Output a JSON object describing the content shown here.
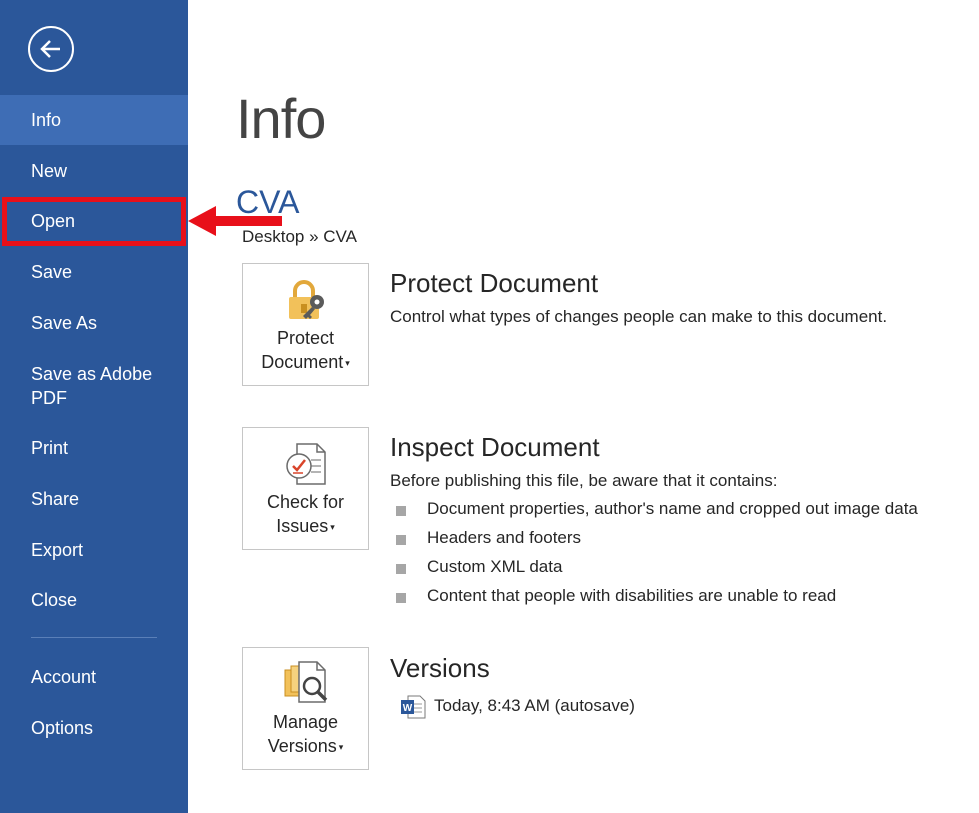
{
  "sidebar": {
    "items": [
      {
        "label": "Info"
      },
      {
        "label": "New"
      },
      {
        "label": "Open"
      },
      {
        "label": "Save"
      },
      {
        "label": "Save As"
      },
      {
        "label": "Save as Adobe PDF"
      },
      {
        "label": "Print"
      },
      {
        "label": "Share"
      },
      {
        "label": "Export"
      },
      {
        "label": "Close"
      },
      {
        "label": "Account"
      },
      {
        "label": "Options"
      }
    ],
    "active_item": "Info"
  },
  "main": {
    "title": "Info",
    "document_name": "CVA",
    "document_path": "Desktop » CVA",
    "protect": {
      "button_line1": "Protect",
      "button_line2": "Document",
      "title": "Protect Document",
      "description": "Control what types of changes people can make to this document."
    },
    "inspect": {
      "button_line1": "Check for",
      "button_line2": "Issues",
      "title": "Inspect Document",
      "description": "Before publishing this file, be aware that it contains:",
      "bullets": [
        "Document properties, author's name and cropped out image data",
        "Headers and footers",
        "Custom XML data",
        "Content that people with disabilities are unable to read"
      ]
    },
    "versions": {
      "button_line1": "Manage",
      "button_line2": "Versions",
      "title": "Versions",
      "entry": "Today, 8:43 AM (autosave)"
    }
  },
  "colors": {
    "sidebar_bg": "#2b579a",
    "sidebar_active": "#3e6db5",
    "accent": "#2b579a",
    "annotation": "#e8101a"
  },
  "icons": [
    "back-arrow-icon",
    "lock-key-icon",
    "checklist-icon",
    "versions-magnifier-icon",
    "word-doc-icon"
  ]
}
